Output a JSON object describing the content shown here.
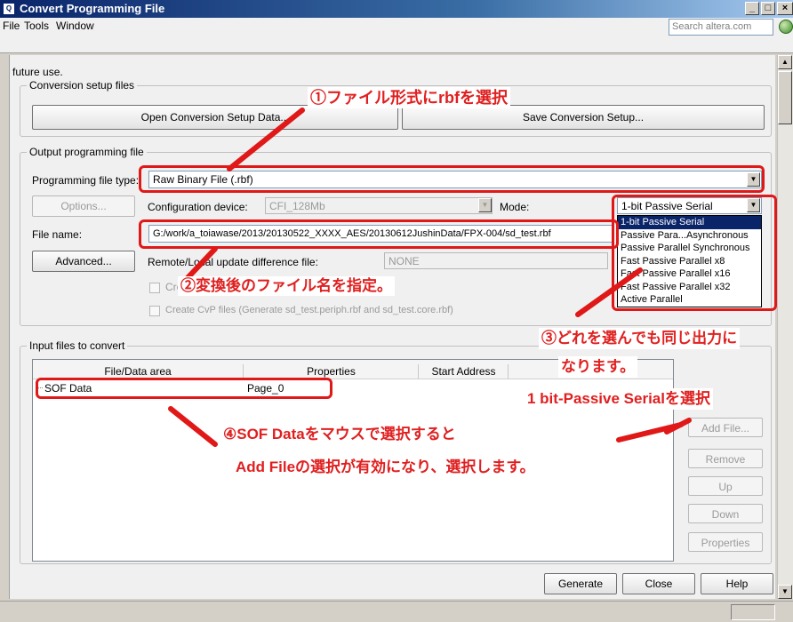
{
  "window": {
    "title": "Convert Programming File",
    "minimize": "_",
    "restore": "□",
    "close": "×"
  },
  "menu": {
    "items": [
      "File",
      "Tools",
      "Window"
    ]
  },
  "search": {
    "placeholder": "Search altera.com"
  },
  "top_text": "future use.",
  "conversion_setup": {
    "group_label": "Conversion setup files",
    "open_button": "Open Conversion Setup Data...",
    "save_button": "Save Conversion Setup..."
  },
  "output": {
    "group_label": "Output programming file",
    "file_type_label": "Programming file type:",
    "file_type_value": "Raw Binary File (.rbf)",
    "options_button": "Options...",
    "config_device_label": "Configuration device:",
    "config_device_value": "CFI_128Mb",
    "mode_label": "Mode:",
    "mode_value": "1-bit Passive Serial",
    "mode_options": [
      "1-bit Passive Serial",
      "Passive Para...Asynchronous",
      "Passive Parallel Synchronous",
      "Fast Passive Parallel x8",
      "Fast Passive Parallel x16",
      "Fast Passive Parallel x32",
      "Active Parallel"
    ],
    "file_name_label": "File name:",
    "file_name_value": "G:/work/a_toiawase/2013/20130522_XXXX_AES/20130612JushinData/FPX-004/sd_test.rbf",
    "advanced_button": "Advanced...",
    "remote_label": "Remote/Local update difference file:",
    "remote_value": "NONE",
    "create_memory_map_label": "Cre",
    "create_cvp_label": "Create CvP files (Generate sd_test.periph.rbf and sd_test.core.rbf)"
  },
  "input": {
    "group_label": "Input files to convert",
    "columns": [
      "File/Data area",
      "Properties",
      "Start Address"
    ],
    "rows": [
      {
        "name": "SOF Data",
        "properties": "Page_0"
      }
    ],
    "buttons": {
      "add_file": "Add File...",
      "remove": "Remove",
      "up": "Up",
      "down": "Down",
      "properties": "Properties"
    }
  },
  "footer": {
    "generate": "Generate",
    "close": "Close",
    "help": "Help"
  },
  "annotations": {
    "a1": "①ファイル形式にrbfを選択",
    "a2": "②変換後のファイル名を指定。",
    "a3_line1": "③どれを選んでも同じ出力に",
    "a3_line2": "なります。",
    "a3_line3": "1 bit-Passive Serialを選択",
    "a4_line1": "④SOF Dataをマウスで選択すると",
    "a4_line2": "Add Fileの選択が有効になり、選択します。"
  },
  "colors": {
    "annotation_red": "#e02020",
    "title_blue": "#0a246a",
    "selection_blue": "#0a246a"
  }
}
